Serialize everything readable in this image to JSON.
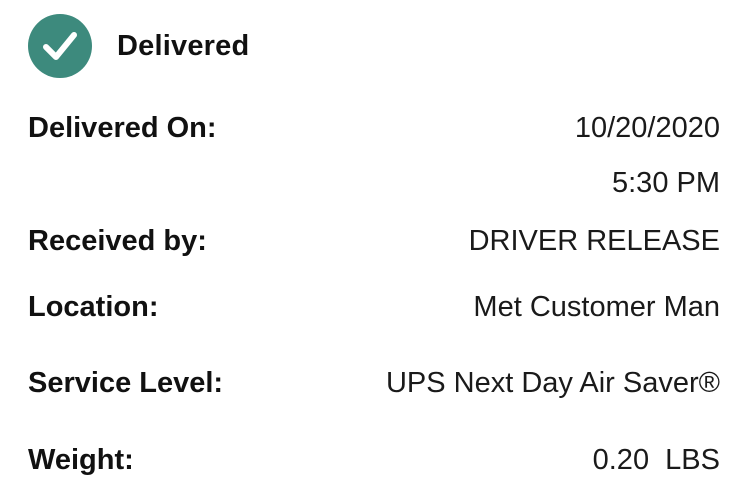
{
  "status": {
    "icon": "checkmark-circle-icon",
    "label": "Delivered",
    "color": "#3d8a7d"
  },
  "details": {
    "delivered_on": {
      "label": "Delivered On:",
      "date": "10/20/2020",
      "time": "5:30 PM"
    },
    "received_by": {
      "label": "Received by:",
      "value": "DRIVER RELEASE"
    },
    "location": {
      "label": "Location:",
      "value": "Met Customer Man"
    },
    "service_level": {
      "label": "Service Level:",
      "value": "UPS Next Day Air Saver®"
    },
    "weight": {
      "label": "Weight:",
      "value": "0.20  LBS"
    }
  }
}
